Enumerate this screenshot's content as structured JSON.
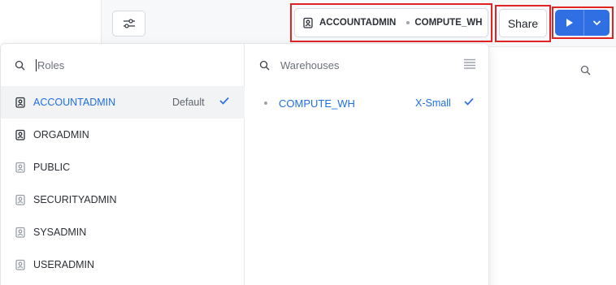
{
  "toolbar": {
    "role_label": "ACCOUNTADMIN",
    "warehouse_label": "COMPUTE_WH",
    "share_label": "Share"
  },
  "roles": {
    "search_placeholder": "Roles",
    "items": [
      {
        "label": "ACCOUNTADMIN",
        "badge": "Default",
        "selected": true
      },
      {
        "label": "ORGADMIN"
      },
      {
        "label": "PUBLIC"
      },
      {
        "label": "SECURITYADMIN"
      },
      {
        "label": "SYSADMIN"
      },
      {
        "label": "USERADMIN"
      }
    ]
  },
  "warehouses": {
    "title": "Warehouses",
    "items": [
      {
        "label": "COMPUTE_WH",
        "size": "X-Small",
        "selected": true
      }
    ]
  },
  "colors": {
    "accent": "#2f6fe3",
    "selected_text": "#1f6fe0",
    "highlight": "#e02424"
  }
}
